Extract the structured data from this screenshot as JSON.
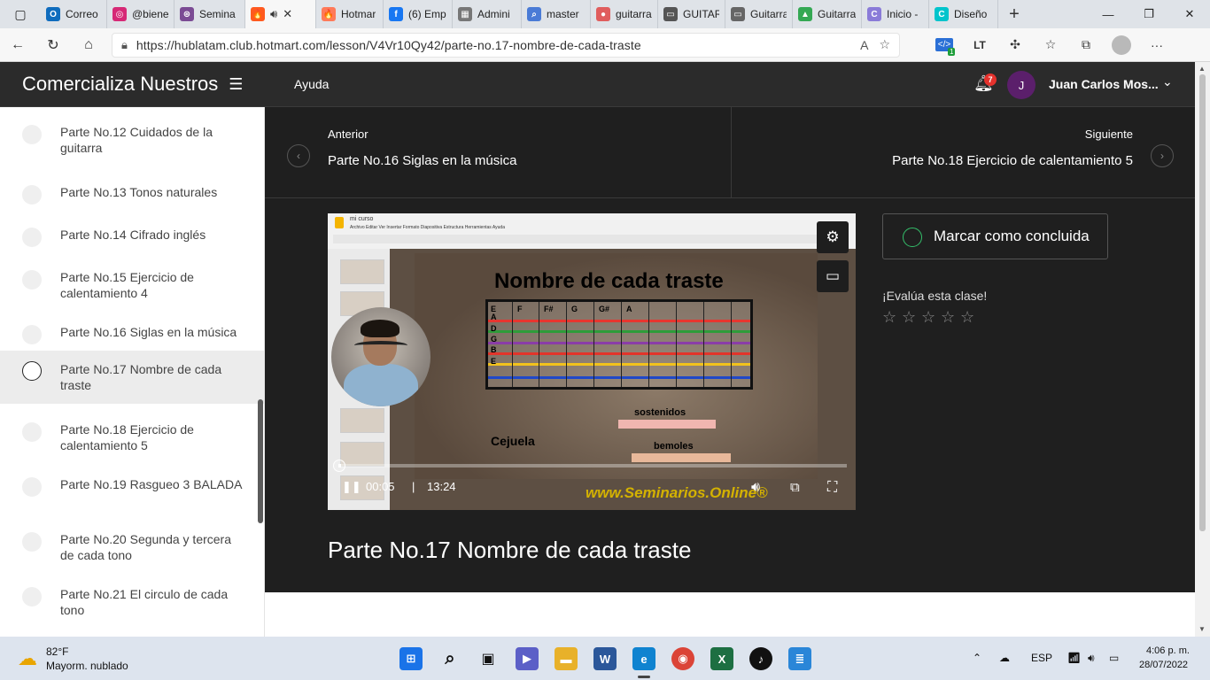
{
  "browser": {
    "tabs": [
      {
        "label": "Correo",
        "color": "#0f6cbd",
        "glyph": "O"
      },
      {
        "label": "@biene",
        "color": "#d62976",
        "glyph": "◎"
      },
      {
        "label": "Semina",
        "color": "#7b4b94",
        "glyph": "⊛"
      },
      {
        "label": "",
        "color": "#ff5a1f",
        "glyph": "🔥",
        "active": true
      },
      {
        "label": "Hotmar",
        "color": "#ff7a59",
        "glyph": "🔥"
      },
      {
        "label": "(6) Emp",
        "color": "#1877f2",
        "glyph": "f"
      },
      {
        "label": "Admini",
        "color": "#777777",
        "glyph": "▦"
      },
      {
        "label": "master",
        "color": "#4a7bd6",
        "glyph": "⌕"
      },
      {
        "label": "guitarra",
        "color": "#e05d5d",
        "glyph": "●"
      },
      {
        "label": "GUITAR",
        "color": "#555555",
        "glyph": "▭"
      },
      {
        "label": "Guitarra",
        "color": "#666666",
        "glyph": "▭"
      },
      {
        "label": "Guitarra",
        "color": "#34a853",
        "glyph": "▲"
      },
      {
        "label": "Inicio -",
        "color": "#8a7bd8",
        "glyph": "C"
      },
      {
        "label": "Diseño",
        "color": "#00c4cc",
        "glyph": "C"
      }
    ],
    "url": "https://hublatam.club.hotmart.com/lesson/V4Vr10Qy42/parte-no.17-nombre-de-cada-traste",
    "ext_badge": "1"
  },
  "sidebar": {
    "title": "Comercializa Nuestros",
    "lessons": [
      {
        "label": "Parte No.12 Cuidados de la guitarra"
      },
      {
        "label": "Parte No.13 Tonos naturales"
      },
      {
        "label": "Parte No.14 Cifrado inglés"
      },
      {
        "label": "Parte No.15 Ejercicio de calentamiento 4"
      },
      {
        "label": "Parte No.16 Siglas en la música"
      },
      {
        "label": "Parte No.17 Nombre de cada traste",
        "active": true
      },
      {
        "label": "Parte No.18 Ejercicio de calentamiento 5"
      },
      {
        "label": "Parte No.19 Rasgueo 3 BALADA"
      },
      {
        "label": "Parte No.20 Segunda y tercera de cada tono"
      },
      {
        "label": "Parte No.21 El circulo de cada tono"
      }
    ]
  },
  "header": {
    "help": "Ayuda",
    "notifications": "7",
    "user_initial": "J",
    "user_name": "Juan Carlos Mos..."
  },
  "nav": {
    "prev_label": "Anterior",
    "prev_title": "Parte No.16 Siglas en la música",
    "next_label": "Siguiente",
    "next_title": "Parte No.18 Ejercicio de calentamiento 5"
  },
  "video": {
    "slides_title": "mi curso",
    "slides_menu": "Archivo   Editar   Ver   Insertar   Formato   Diapositiva   Estructura   Herramientas   Ayuda",
    "slide_heading": "Nombre de cada traste",
    "fret_headers": [
      "E",
      "F",
      "F#",
      "G",
      "G#",
      "A"
    ],
    "string_labels": [
      "A",
      "D",
      "G",
      "B",
      "E"
    ],
    "cejuela": "Cejuela",
    "sostenidos": "sostenidos",
    "bemoles": "bemoles",
    "current_time": "00:05",
    "duration": "13:24",
    "progress": 0.006,
    "watermark": "www.Seminarios.Online®"
  },
  "lesson": {
    "complete_label": "Marcar como concluida",
    "rate_label": "¡Evalúa esta clase!",
    "stars": 5,
    "title": "Parte No.17 Nombre de cada traste"
  },
  "taskbar": {
    "temp": "82°F",
    "weather": "Mayorm. nublado",
    "lang": "ESP",
    "time": "4:06 p. m.",
    "date": "28/07/2022"
  }
}
